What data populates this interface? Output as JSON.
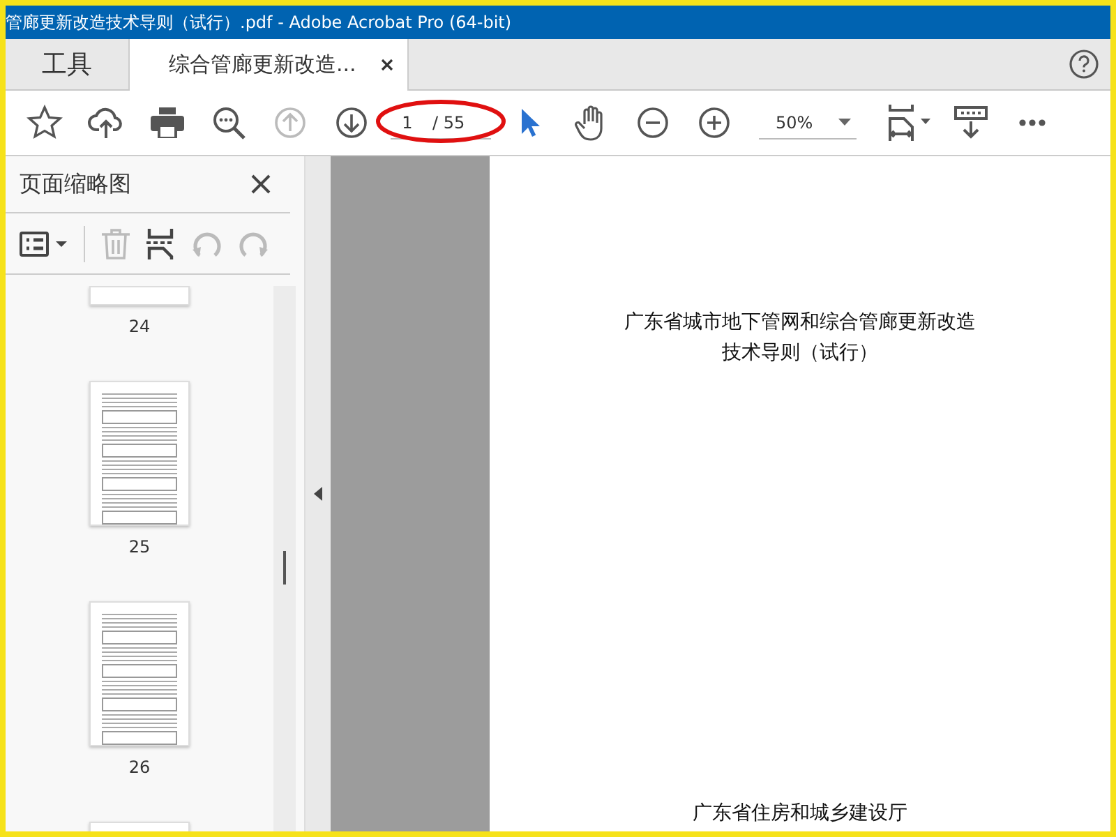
{
  "window": {
    "title": "管廊更新改造技术导则（试行）.pdf - Adobe Acrobat Pro (64-bit)"
  },
  "tabs": [
    {
      "label": "工具",
      "selected": false,
      "closable": false
    },
    {
      "label": "综合管廊更新改造...",
      "selected": true,
      "closable": true
    }
  ],
  "toolbar": {
    "items": [
      {
        "kind": "star",
        "disabled": false
      },
      {
        "kind": "upload",
        "disabled": false
      },
      {
        "kind": "print",
        "disabled": false
      },
      {
        "kind": "zoom-search",
        "disabled": false
      },
      {
        "kind": "prev",
        "disabled": true
      },
      {
        "kind": "next",
        "disabled": false
      },
      {
        "kind": "page",
        "value": "1",
        "total": "/ 55"
      },
      {
        "kind": "select",
        "selected": true
      },
      {
        "kind": "hand",
        "selected": false
      },
      {
        "kind": "zoom-out",
        "disabled": false
      },
      {
        "kind": "zoom-in",
        "disabled": false
      },
      {
        "kind": "zoom",
        "value": "50%"
      },
      {
        "kind": "fit",
        "disabled": false
      },
      {
        "kind": "read",
        "disabled": false
      },
      {
        "kind": "more",
        "disabled": false
      }
    ]
  },
  "sidebar": {
    "title": "页面缩略图",
    "tools": [
      {
        "kind": "options",
        "disabled": false
      },
      {
        "kind": "delete",
        "disabled": true
      },
      {
        "kind": "insert",
        "disabled": false
      },
      {
        "kind": "undo",
        "disabled": true
      },
      {
        "kind": "redo",
        "disabled": true
      }
    ],
    "thumbnails": [
      {
        "label": "24",
        "kind": "tail"
      },
      {
        "label": "25",
        "kind": "full"
      },
      {
        "label": "26",
        "kind": "full"
      },
      {
        "kind": "head"
      }
    ]
  },
  "document": {
    "title_lines": [
      "广东省城市地下管网和综合管廊更新改造",
      "技术导则（试行）"
    ],
    "footer": "广东省住房和城乡建设厅"
  }
}
